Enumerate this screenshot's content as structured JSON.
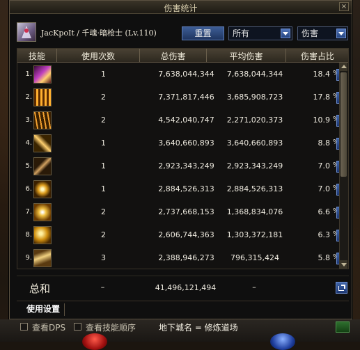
{
  "window": {
    "title": "伤害统计",
    "close_glyph": "×"
  },
  "player": {
    "label": "JacKpoIt / 千魂·暗枪士 (Lv.110)"
  },
  "controls": {
    "reset_label": "重置",
    "filter_value": "所有",
    "sort_value": "伤害"
  },
  "columns": [
    "技能",
    "使用次数",
    "总伤害",
    "平均伤害",
    "伤害占比"
  ],
  "rows": [
    {
      "index": "1.",
      "icon": "skill-icon-purple-flame",
      "count": "1",
      "total": "7,638,044,344",
      "avg": "7,638,044,344",
      "pct": "18.4",
      "pct_unit": "%"
    },
    {
      "index": "2.",
      "icon": "skill-icon-fire-pillars",
      "count": "2",
      "total": "7,371,817,446",
      "avg": "3,685,908,723",
      "pct": "17.8",
      "pct_unit": "%"
    },
    {
      "index": "3.",
      "icon": "skill-icon-spear-rain",
      "count": "2",
      "total": "4,542,040,747",
      "avg": "2,271,020,373",
      "pct": "10.9",
      "pct_unit": "%"
    },
    {
      "index": "4.",
      "icon": "skill-icon-slash",
      "count": "1",
      "total": "3,640,660,893",
      "avg": "3,640,660,893",
      "pct": "8.8",
      "pct_unit": "%"
    },
    {
      "index": "5.",
      "icon": "skill-icon-spear-thrust",
      "count": "1",
      "total": "2,923,343,249",
      "avg": "2,923,343,249",
      "pct": "7.0",
      "pct_unit": "%"
    },
    {
      "index": "6.",
      "icon": "skill-icon-cross-burst",
      "count": "1",
      "total": "2,884,526,313",
      "avg": "2,884,526,313",
      "pct": "7.0",
      "pct_unit": "%"
    },
    {
      "index": "7.",
      "icon": "skill-icon-star-burst",
      "count": "2",
      "total": "2,737,668,153",
      "avg": "1,368,834,076",
      "pct": "6.6",
      "pct_unit": "%"
    },
    {
      "index": "8.",
      "icon": "skill-icon-golden-flare",
      "count": "2",
      "total": "2,606,744,363",
      "avg": "1,303,372,181",
      "pct": "6.3",
      "pct_unit": "%"
    },
    {
      "index": "9.",
      "icon": "skill-icon-wind-blade",
      "count": "3",
      "total": "2,388,946,273",
      "avg": "796,315,424",
      "pct": "5.8",
      "pct_unit": "%"
    }
  ],
  "summary": {
    "label": "总和",
    "count": "–",
    "total": "41,496,121,494",
    "avg": "–"
  },
  "tabs": {
    "settings_label": "使用设置"
  },
  "bottom": {
    "show_dps_label": "查看DPS",
    "show_order_label": "查看技能顺序",
    "dungeon_text": "地下城名 = 修炼道场"
  },
  "colors": {
    "accent_blue": "#2f4f8f",
    "header_brown": "#4a4234",
    "window_bg": "#0f0f0f"
  }
}
